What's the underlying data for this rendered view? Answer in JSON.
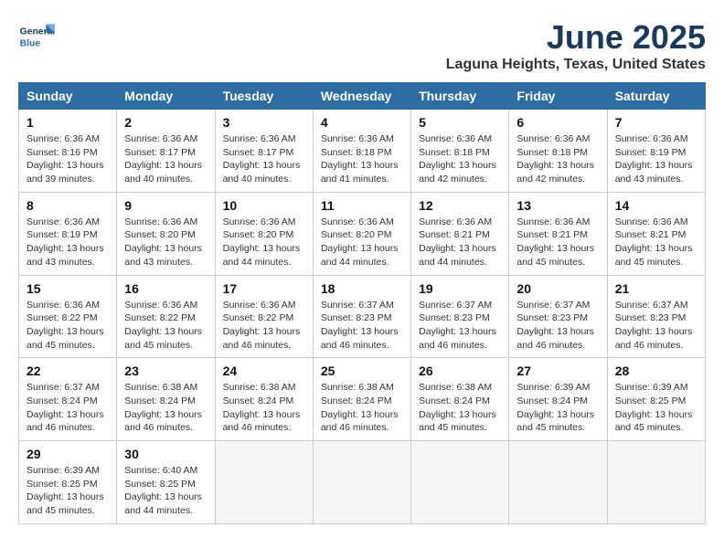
{
  "logo": {
    "line1": "General",
    "line2": "Blue"
  },
  "title": "June 2025",
  "subtitle": "Laguna Heights, Texas, United States",
  "days_of_week": [
    "Sunday",
    "Monday",
    "Tuesday",
    "Wednesday",
    "Thursday",
    "Friday",
    "Saturday"
  ],
  "weeks": [
    [
      {
        "day": "1",
        "info": "Sunrise: 6:36 AM\nSunset: 8:16 PM\nDaylight: 13 hours\nand 39 minutes."
      },
      {
        "day": "2",
        "info": "Sunrise: 6:36 AM\nSunset: 8:17 PM\nDaylight: 13 hours\nand 40 minutes."
      },
      {
        "day": "3",
        "info": "Sunrise: 6:36 AM\nSunset: 8:17 PM\nDaylight: 13 hours\nand 40 minutes."
      },
      {
        "day": "4",
        "info": "Sunrise: 6:36 AM\nSunset: 8:18 PM\nDaylight: 13 hours\nand 41 minutes."
      },
      {
        "day": "5",
        "info": "Sunrise: 6:36 AM\nSunset: 8:18 PM\nDaylight: 13 hours\nand 42 minutes."
      },
      {
        "day": "6",
        "info": "Sunrise: 6:36 AM\nSunset: 8:18 PM\nDaylight: 13 hours\nand 42 minutes."
      },
      {
        "day": "7",
        "info": "Sunrise: 6:36 AM\nSunset: 8:19 PM\nDaylight: 13 hours\nand 43 minutes."
      }
    ],
    [
      {
        "day": "8",
        "info": "Sunrise: 6:36 AM\nSunset: 8:19 PM\nDaylight: 13 hours\nand 43 minutes."
      },
      {
        "day": "9",
        "info": "Sunrise: 6:36 AM\nSunset: 8:20 PM\nDaylight: 13 hours\nand 43 minutes."
      },
      {
        "day": "10",
        "info": "Sunrise: 6:36 AM\nSunset: 8:20 PM\nDaylight: 13 hours\nand 44 minutes."
      },
      {
        "day": "11",
        "info": "Sunrise: 6:36 AM\nSunset: 8:20 PM\nDaylight: 13 hours\nand 44 minutes."
      },
      {
        "day": "12",
        "info": "Sunrise: 6:36 AM\nSunset: 8:21 PM\nDaylight: 13 hours\nand 44 minutes."
      },
      {
        "day": "13",
        "info": "Sunrise: 6:36 AM\nSunset: 8:21 PM\nDaylight: 13 hours\nand 45 minutes."
      },
      {
        "day": "14",
        "info": "Sunrise: 6:36 AM\nSunset: 8:21 PM\nDaylight: 13 hours\nand 45 minutes."
      }
    ],
    [
      {
        "day": "15",
        "info": "Sunrise: 6:36 AM\nSunset: 8:22 PM\nDaylight: 13 hours\nand 45 minutes."
      },
      {
        "day": "16",
        "info": "Sunrise: 6:36 AM\nSunset: 8:22 PM\nDaylight: 13 hours\nand 45 minutes."
      },
      {
        "day": "17",
        "info": "Sunrise: 6:36 AM\nSunset: 8:22 PM\nDaylight: 13 hours\nand 46 minutes."
      },
      {
        "day": "18",
        "info": "Sunrise: 6:37 AM\nSunset: 8:23 PM\nDaylight: 13 hours\nand 46 minutes."
      },
      {
        "day": "19",
        "info": "Sunrise: 6:37 AM\nSunset: 8:23 PM\nDaylight: 13 hours\nand 46 minutes."
      },
      {
        "day": "20",
        "info": "Sunrise: 6:37 AM\nSunset: 8:23 PM\nDaylight: 13 hours\nand 46 minutes."
      },
      {
        "day": "21",
        "info": "Sunrise: 6:37 AM\nSunset: 8:23 PM\nDaylight: 13 hours\nand 46 minutes."
      }
    ],
    [
      {
        "day": "22",
        "info": "Sunrise: 6:37 AM\nSunset: 8:24 PM\nDaylight: 13 hours\nand 46 minutes."
      },
      {
        "day": "23",
        "info": "Sunrise: 6:38 AM\nSunset: 8:24 PM\nDaylight: 13 hours\nand 46 minutes."
      },
      {
        "day": "24",
        "info": "Sunrise: 6:38 AM\nSunset: 8:24 PM\nDaylight: 13 hours\nand 46 minutes."
      },
      {
        "day": "25",
        "info": "Sunrise: 6:38 AM\nSunset: 8:24 PM\nDaylight: 13 hours\nand 46 minutes."
      },
      {
        "day": "26",
        "info": "Sunrise: 6:38 AM\nSunset: 8:24 PM\nDaylight: 13 hours\nand 45 minutes."
      },
      {
        "day": "27",
        "info": "Sunrise: 6:39 AM\nSunset: 8:24 PM\nDaylight: 13 hours\nand 45 minutes."
      },
      {
        "day": "28",
        "info": "Sunrise: 6:39 AM\nSunset: 8:25 PM\nDaylight: 13 hours\nand 45 minutes."
      }
    ],
    [
      {
        "day": "29",
        "info": "Sunrise: 6:39 AM\nSunset: 8:25 PM\nDaylight: 13 hours\nand 45 minutes."
      },
      {
        "day": "30",
        "info": "Sunrise: 6:40 AM\nSunset: 8:25 PM\nDaylight: 13 hours\nand 44 minutes."
      },
      {
        "day": "",
        "info": ""
      },
      {
        "day": "",
        "info": ""
      },
      {
        "day": "",
        "info": ""
      },
      {
        "day": "",
        "info": ""
      },
      {
        "day": "",
        "info": ""
      }
    ]
  ]
}
